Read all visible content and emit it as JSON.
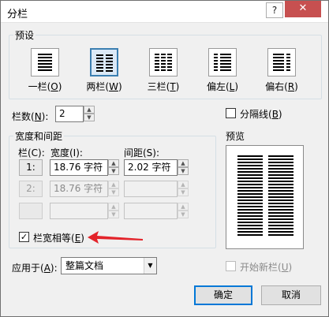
{
  "window": {
    "title": "分栏",
    "help_label": "?",
    "close_label": "✕"
  },
  "presets": {
    "group_label": "预设",
    "items": [
      {
        "label": "一栏(",
        "key": "O",
        "suffix": ")"
      },
      {
        "label": "两栏(",
        "key": "W",
        "suffix": ")"
      },
      {
        "label": "三栏(",
        "key": "T",
        "suffix": ")"
      },
      {
        "label": "偏左(",
        "key": "L",
        "suffix": ")"
      },
      {
        "label": "偏右(",
        "key": "R",
        "suffix": ")"
      }
    ],
    "selected_index": 1
  },
  "column_count": {
    "label_pre": "栏数(",
    "key": "N",
    "label_post": "):",
    "value": "2"
  },
  "divider": {
    "label_pre": "分隔线(",
    "key": "B",
    "label_post": ")",
    "checked": false
  },
  "width_spacing": {
    "group_label": "宽度和间距",
    "col_header": "栏(C):",
    "width_header": "宽度(I):",
    "spacing_header": "间距(S):",
    "rows": [
      {
        "num": "1:",
        "width": "18.76 字符",
        "spacing": "2.02 字符",
        "enabled": true
      },
      {
        "num": "2:",
        "width": "18.76 字符",
        "spacing": "",
        "enabled": false
      },
      {
        "num": "",
        "width": "",
        "spacing": "",
        "enabled": false
      }
    ]
  },
  "equal_width": {
    "label_pre": "栏宽相等(",
    "key": "E",
    "label_post": ")",
    "checked": true,
    "checkmark": "✓"
  },
  "preview": {
    "label": "预览"
  },
  "apply_to": {
    "label_pre": "应用于(",
    "key": "A",
    "label_post": "):",
    "value": "整篇文档",
    "arrow": "▼"
  },
  "new_column": {
    "label_pre": "开始新栏(",
    "key": "U",
    "label_post": ")",
    "checked": false
  },
  "buttons": {
    "ok": "确定",
    "cancel": "取消"
  },
  "spin": {
    "up": "▲",
    "down": "▼"
  },
  "colors": {
    "accent": "#0078d7",
    "annotation_arrow": "#e3232a"
  }
}
